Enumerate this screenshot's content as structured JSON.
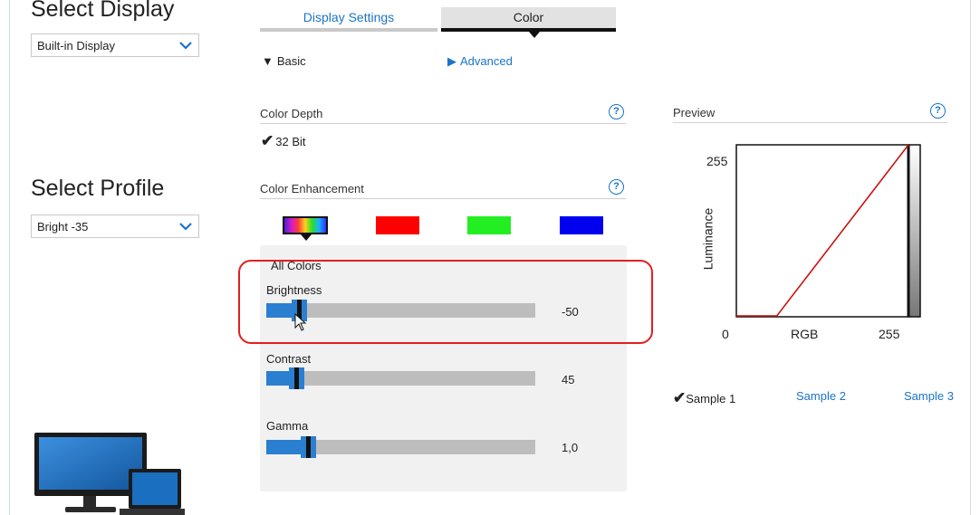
{
  "left": {
    "display_title": "Select Display",
    "display_value": "Built-in Display",
    "profile_title": "Select Profile",
    "profile_value": "Bright -35"
  },
  "tabs": {
    "display_settings": "Display Settings",
    "color": "Color"
  },
  "modes": {
    "basic": "Basic",
    "advanced": "Advanced"
  },
  "color_depth": {
    "label": "Color Depth",
    "value": "32 Bit"
  },
  "color_enhancement": {
    "label": "Color Enhancement",
    "panel_title": "All Colors",
    "sliders": [
      {
        "label": "Brightness",
        "value": "-50",
        "level": 0.12
      },
      {
        "label": "Contrast",
        "value": "45",
        "level": 0.11
      },
      {
        "label": "Gamma",
        "value": "1,0",
        "level": 0.155
      }
    ]
  },
  "preview": {
    "label": "Preview",
    "y_axis": "Luminance",
    "y_max": "255",
    "x_min": "0",
    "x_axis": "RGB",
    "x_max": "255",
    "samples": [
      "Sample 1",
      "Sample 2",
      "Sample 3"
    ],
    "active_sample": "Sample 1"
  },
  "colors": {
    "accent": "#1a73c9",
    "curve": "#cc1111",
    "highlight": "#e02020"
  }
}
